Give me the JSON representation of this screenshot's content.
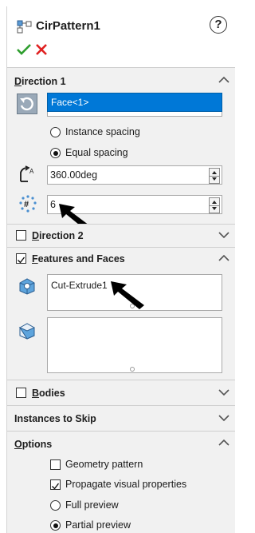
{
  "header": {
    "title": "CirPattern1",
    "help_symbol": "?"
  },
  "direction1": {
    "label_prefix": "D",
    "label_rest": "irection 1",
    "face_value": "Face<1>",
    "instance_spacing_label": "Instance spacing",
    "equal_spacing_label": "Equal spacing",
    "selected_spacing": "Equal spacing",
    "angle_value": "360.00deg",
    "count_value": "6"
  },
  "direction2": {
    "label_prefix": "D",
    "label_rest": "irection 2",
    "checked": false
  },
  "features": {
    "label_prefix": "F",
    "label_rest": "eatures and Faces",
    "checked": true,
    "feature_item": "Cut-Extrude1"
  },
  "bodies": {
    "label_prefix": "B",
    "label_rest": "odies",
    "checked": false
  },
  "skip": {
    "label": "Instances to Skip"
  },
  "options": {
    "label_prefix": "O",
    "label_rest": "ptions",
    "geometry_pattern_label": "Geometry pattern",
    "geometry_pattern_checked": false,
    "propagate_label": "Propagate visual properties",
    "propagate_checked": true,
    "full_preview_label": "Full preview",
    "partial_preview_label": "Partial preview",
    "selected_preview": "Partial preview"
  },
  "colors": {
    "selection_highlight": "#0078d7",
    "ok_green": "#2e9e2e",
    "cancel_red": "#e02020",
    "section_bg": "#f1f1f1"
  }
}
